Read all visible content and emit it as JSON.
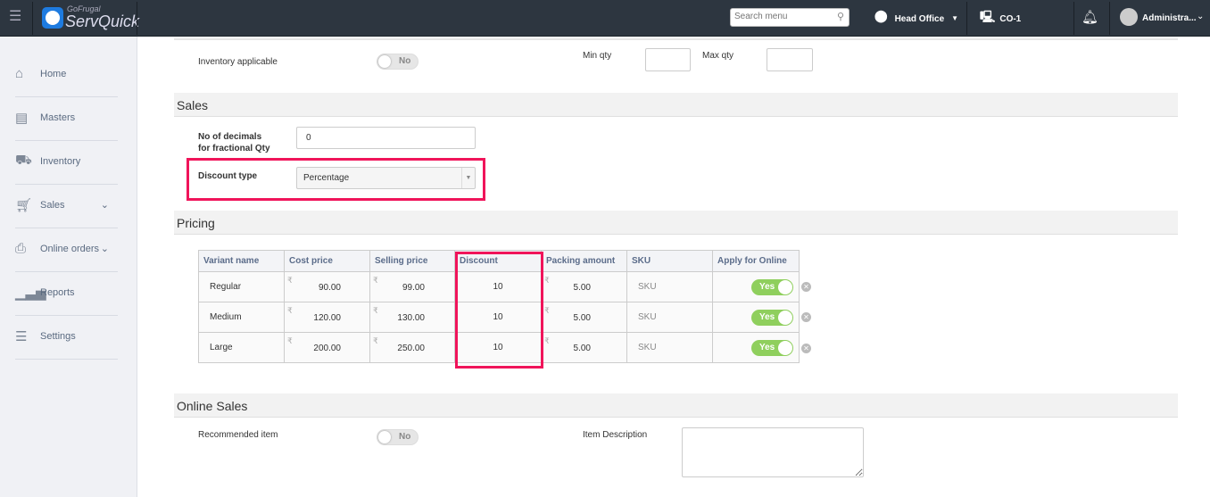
{
  "header": {
    "brand_top": "GoFrugal",
    "brand": "ServQuick",
    "search_placeholder": "Search menu",
    "location": "Head Office",
    "counter": "CO-1",
    "user": "Administra..."
  },
  "sidebar": {
    "items": [
      {
        "label": "Home",
        "icon": "home-icon"
      },
      {
        "label": "Masters",
        "icon": "masters-icon"
      },
      {
        "label": "Inventory",
        "icon": "inventory-icon"
      },
      {
        "label": "Sales",
        "icon": "cart-icon",
        "chevron": true
      },
      {
        "label": "Online orders",
        "icon": "online-orders-icon",
        "chevron": true
      },
      {
        "label": "Reports",
        "icon": "reports-icon"
      },
      {
        "label": "Settings",
        "icon": "settings-icon"
      }
    ]
  },
  "inventory": {
    "applicable_label": "Inventory applicable",
    "applicable_value": "No",
    "min_qty_label": "Min qty",
    "max_qty_label": "Max qty"
  },
  "sales": {
    "title": "Sales",
    "decimals_label_1": "No of decimals",
    "decimals_label_2": "for fractional Qty",
    "decimals_value": "0",
    "discount_type_label": "Discount type",
    "discount_type_value": "Percentage"
  },
  "pricing": {
    "title": "Pricing",
    "columns": [
      "Variant name",
      "Cost price",
      "Selling price",
      "Discount",
      "Packing amount",
      "SKU",
      "Apply for Online"
    ],
    "currency": "₹",
    "rows": [
      {
        "name": "Regular",
        "cost": "90.00",
        "sell": "99.00",
        "discount": "10",
        "packing": "5.00",
        "sku": "SKU",
        "online": "Yes"
      },
      {
        "name": "Medium",
        "cost": "120.00",
        "sell": "130.00",
        "discount": "10",
        "packing": "5.00",
        "sku": "SKU",
        "online": "Yes"
      },
      {
        "name": "Large",
        "cost": "200.00",
        "sell": "250.00",
        "discount": "10",
        "packing": "5.00",
        "sku": "SKU",
        "online": "Yes"
      }
    ]
  },
  "online_sales": {
    "title": "Online Sales",
    "recommended_label": "Recommended item",
    "recommended_value": "No",
    "description_label": "Item Description"
  }
}
